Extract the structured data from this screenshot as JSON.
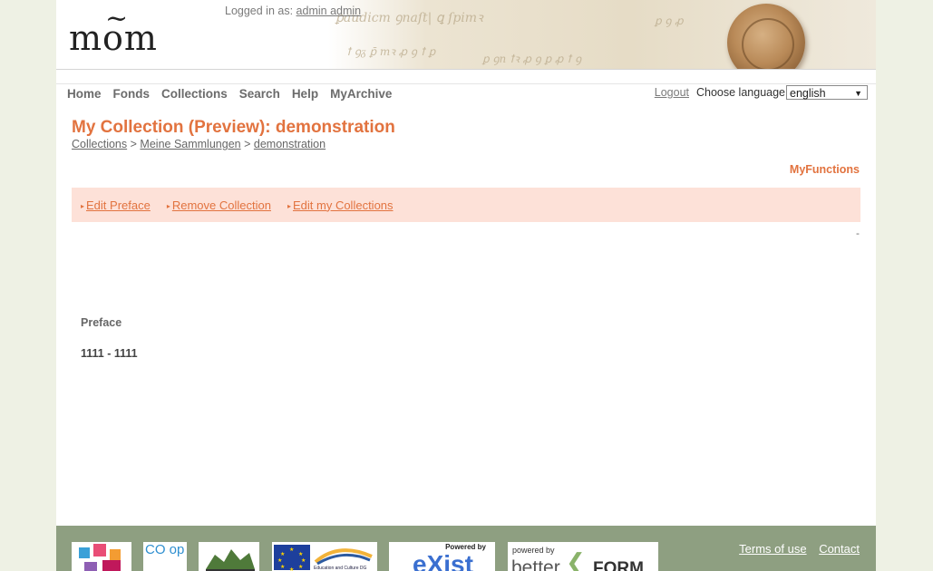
{
  "header": {
    "logo_text": "mom",
    "login_prefix": "Logged in as:",
    "login_user": "admin admin"
  },
  "nav": {
    "items": [
      "Home",
      "Fonds",
      "Collections",
      "Search",
      "Help",
      "MyArchive"
    ],
    "logout": "Logout",
    "choose_language": "Choose language",
    "language_selected": "english"
  },
  "main": {
    "title": "My Collection (Preview): demonstration",
    "breadcrumb": [
      "Collections",
      "Meine Sammlungen",
      "demonstration"
    ],
    "breadcrumb_sep": ">",
    "myfunctions_label": "MyFunctions",
    "functions": [
      "Edit Preface",
      "Remove Collection",
      "Edit my Collections"
    ],
    "dash": "-",
    "preface_label": "Preface",
    "date_range": "1111 - 1111"
  },
  "footer": {
    "links": [
      "Terms of use",
      "Contact"
    ],
    "logo_texts": {
      "coop": "CO op",
      "eu": "Education and Culture DG",
      "exist_powered": "Powered by",
      "exist": "eXist",
      "betterform_small": "powered by",
      "betterform_big": "better",
      "betterform_form": "FORM"
    }
  },
  "colors": {
    "accent": "#e2733f",
    "function_bar": "#fde1d8",
    "footer": "#8e9f81",
    "page_bg": "#eef1e4"
  }
}
